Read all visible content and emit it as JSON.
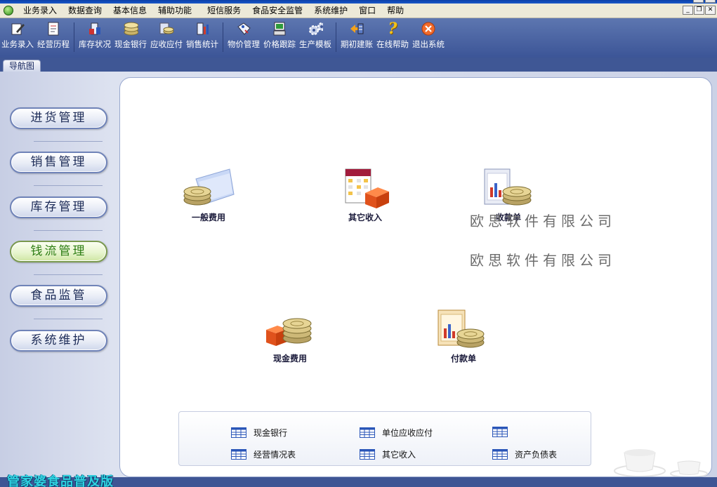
{
  "menubar": {
    "items": [
      "业务录入",
      "数据查询",
      "基本信息",
      "辅助功能",
      "短信服务",
      "食品安全监管",
      "系统维护",
      "窗口",
      "帮助"
    ]
  },
  "toolbar": {
    "groups": [
      [
        "业务录入",
        "经营历程"
      ],
      [
        "库存状况",
        "现金银行",
        "应收应付",
        "销售统计"
      ],
      [
        "物价管理",
        "价格跟踪",
        "生产模板"
      ],
      [
        "期初建账",
        "在线帮助",
        "退出系统"
      ]
    ]
  },
  "nav_tab": "导航图",
  "sidebar": {
    "items": [
      {
        "label": "进货管理",
        "active": false
      },
      {
        "label": "销售管理",
        "active": false
      },
      {
        "label": "库存管理",
        "active": false
      },
      {
        "label": "钱流管理",
        "active": true
      },
      {
        "label": "食品监管",
        "active": false
      },
      {
        "label": "系统维护",
        "active": false
      }
    ]
  },
  "features": {
    "general_expense": "一般费用",
    "other_income": "其它收入",
    "receipt": "收款单",
    "cash_expense": "现金费用",
    "payment": "付款单"
  },
  "watermark": [
    "欧思软件有限公司",
    "欧思软件有限公司"
  ],
  "reports": {
    "cash_bank": "现金银行",
    "unit_ar_ap": "单位应收应付",
    "blank": "",
    "business_status": "经营情况表",
    "other_income": "其它收入",
    "balance_sheet": "资产负债表"
  },
  "brand": "管家婆食品普及版",
  "colors": {
    "toolbar_bg": "#3c5597",
    "active_nav_text": "#2d7d14",
    "brand_text": "#2fd2e0"
  }
}
